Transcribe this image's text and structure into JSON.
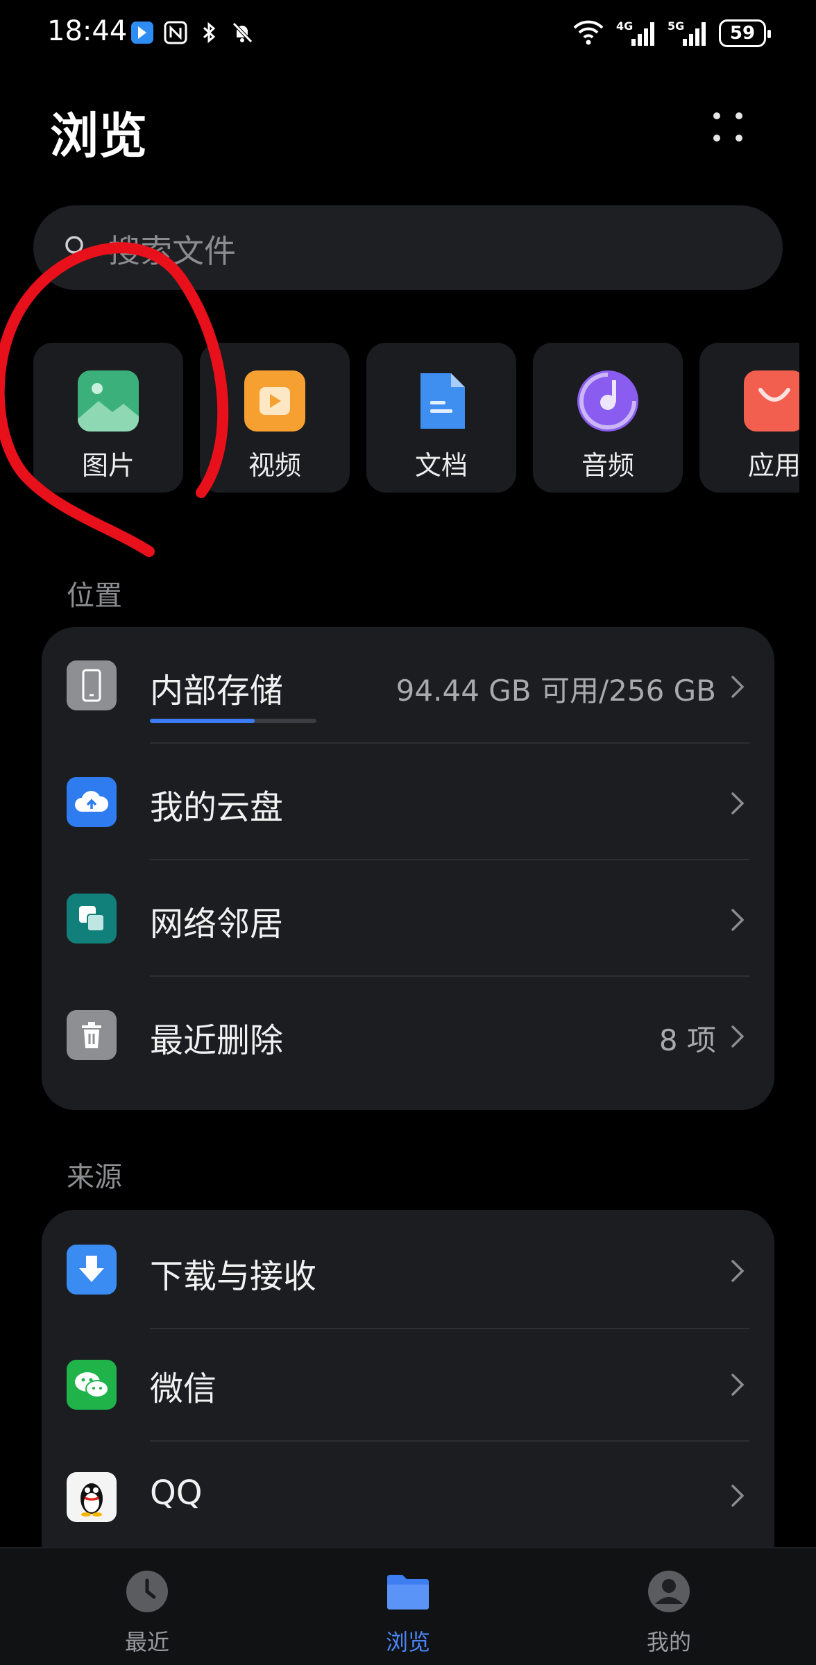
{
  "status_bar": {
    "time": "18:44",
    "battery": "59",
    "icons": [
      "app-notification-icon",
      "nfc-icon",
      "bluetooth-icon",
      "mute-icon",
      "wifi-icon",
      "signal-4g-icon",
      "signal-5g-icon"
    ],
    "network_1": "4G",
    "network_2": "5G"
  },
  "header": {
    "title": "浏览",
    "more_icon": "more-grid-icon"
  },
  "search": {
    "placeholder": "搜索文件"
  },
  "categories": [
    {
      "label": "图片",
      "icon": "image-icon",
      "color": "#3bb07a"
    },
    {
      "label": "视频",
      "icon": "video-icon",
      "color": "#f5a030"
    },
    {
      "label": "文档",
      "icon": "document-icon",
      "color": "#3f8ff0"
    },
    {
      "label": "音频",
      "icon": "audio-icon",
      "color": "#8a5cf0"
    },
    {
      "label": "应用",
      "icon": "app-icon",
      "color": "#f25f4f"
    }
  ],
  "location": {
    "section_label": "位置",
    "items": [
      {
        "label": "内部存储",
        "value": "94.44 GB 可用/256 GB",
        "icon": "phone-icon",
        "storage_used_fraction": 0.63
      },
      {
        "label": "我的云盘",
        "value": "",
        "icon": "cloud-icon"
      },
      {
        "label": "网络邻居",
        "value": "",
        "icon": "network-icon"
      },
      {
        "label": "最近删除",
        "value": "8 项",
        "icon": "trash-icon"
      }
    ]
  },
  "sources": {
    "section_label": "来源",
    "items": [
      {
        "label": "下载与接收",
        "icon": "download-icon"
      },
      {
        "label": "微信",
        "icon": "wechat-icon"
      },
      {
        "label": "QQ",
        "icon": "qq-icon"
      }
    ]
  },
  "bottom_nav": {
    "items": [
      {
        "label": "最近",
        "icon": "clock-icon",
        "active": false
      },
      {
        "label": "浏览",
        "icon": "folder-icon",
        "active": true
      },
      {
        "label": "我的",
        "icon": "profile-icon",
        "active": false
      }
    ]
  },
  "colors": {
    "background": "#000000",
    "card": "#1c1d21",
    "accent": "#4a86f7",
    "annotation": "#e8101a"
  }
}
